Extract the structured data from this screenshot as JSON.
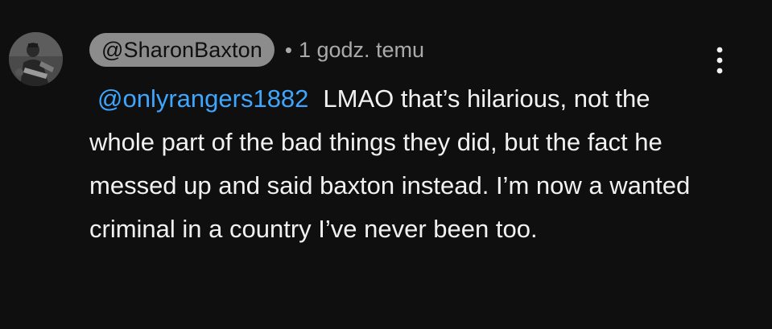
{
  "comment": {
    "author": "@SharonBaxton",
    "separator": "•",
    "timestamp": "1 godz. temu",
    "mention": "@onlyrangers1882",
    "text": "LMAO that’s hilarious, not the whole part of the bad things they did, but the fact he messed up and said baxton instead. I’m now a wanted criminal in a country I’ve never been too.",
    "menu_icon": "more-vertical-icon",
    "avatar_icon": "avatar-image"
  },
  "colors": {
    "background": "#0f0f0f",
    "text": "#f1f1f1",
    "secondary_text": "#aaaaaa",
    "author_chip_bg": "#8c8c8c",
    "mention": "#3ea6ff"
  }
}
